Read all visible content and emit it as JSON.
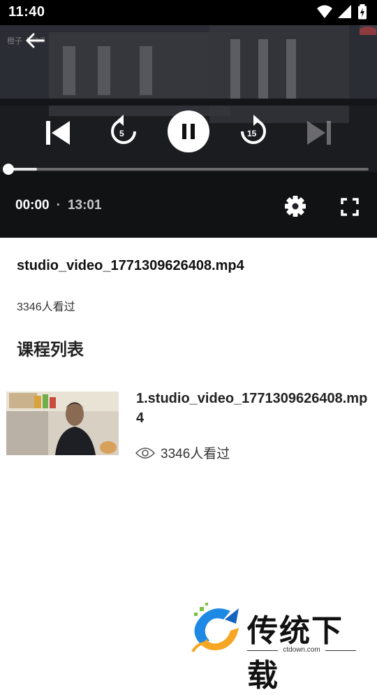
{
  "status_bar": {
    "time": "11:40"
  },
  "player": {
    "watermark_left": "橙子",
    "watermark_brand": "bilibili",
    "rewind_seconds": "5",
    "forward_seconds": "15",
    "current_time": "00:00",
    "separator": "·",
    "duration": "13:01",
    "progress": 0.0,
    "buffered": 0.08
  },
  "video": {
    "title": "studio_video_1771309626408.mp4",
    "views": "3346人看过"
  },
  "course_list": {
    "heading": "课程列表",
    "items": [
      {
        "title": "1.studio_video_1771309626408.mp4",
        "views": "3346人看过"
      }
    ]
  },
  "brand": {
    "name": "传统下载",
    "url": "ctdown.com"
  },
  "colors": {
    "accent_blue": "#1e88e5",
    "accent_orange": "#f5a623",
    "accent_green": "#7cc242"
  }
}
